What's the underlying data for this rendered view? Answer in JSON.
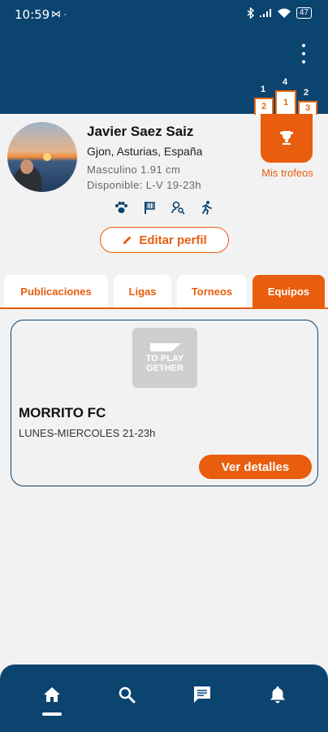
{
  "status_bar": {
    "time": "10:59",
    "left_icons": "⋈ ·",
    "battery": "47"
  },
  "header": {
    "menu_icon": "more-vert-icon"
  },
  "podium": {
    "first": "1",
    "second": "2",
    "third": "3",
    "count_first": "4",
    "count_second": "1",
    "count_third": "2"
  },
  "trophies": {
    "label": "Mis trofeos",
    "icon": "trophy-icon"
  },
  "profile": {
    "name": "Javier Saez Saiz",
    "location": "Gjon, Asturias, España",
    "gender_height": "Masculino 1.91 cm",
    "availability": "Disponible: L-V 19-23h",
    "sports_icons": [
      "paw-icon",
      "flag-icon",
      "person-search-icon",
      "runner-icon"
    ],
    "edit_label": "Editar perfil"
  },
  "tabs": [
    {
      "label": "Publicaciones",
      "active": false
    },
    {
      "label": "Ligas",
      "active": false
    },
    {
      "label": "Torneos",
      "active": false
    },
    {
      "label": "Equipos",
      "active": true
    }
  ],
  "team": {
    "logo_line1": "TO PLAY",
    "logo_line2": "GETHER",
    "name": "MORRITO FC",
    "schedule": "LUNES-MIERCOLES 21-23h",
    "details_label": "Ver detalles"
  },
  "bottom_nav": [
    "home-icon",
    "search-icon",
    "chat-icon",
    "bell-icon"
  ],
  "colors": {
    "primary": "#0c4470",
    "accent": "#e85d0e",
    "background": "#f2f2f2"
  }
}
